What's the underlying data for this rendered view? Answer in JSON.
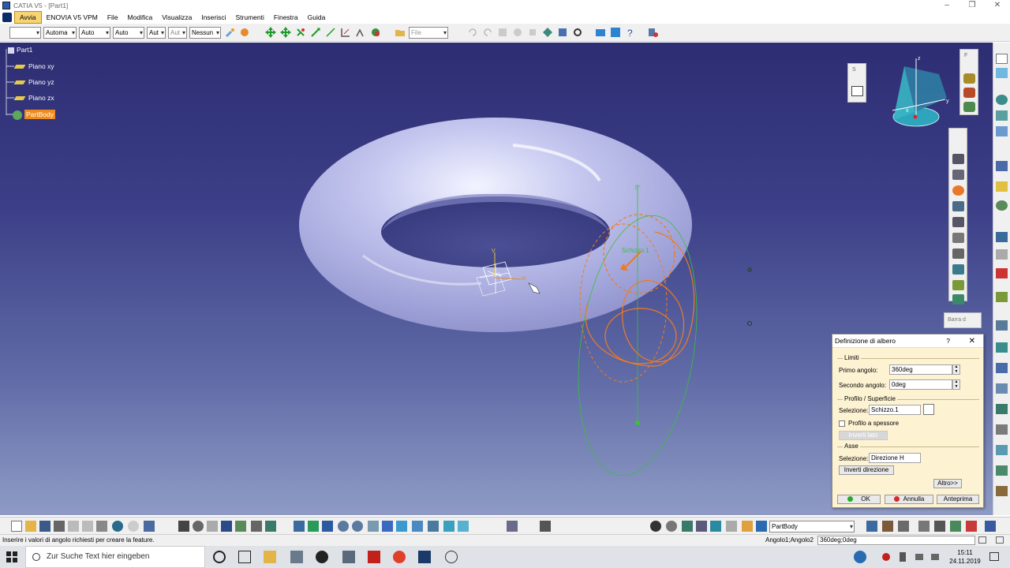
{
  "window": {
    "title": "CATIA V5 - [Part1]"
  },
  "menu": [
    "Avvia",
    "ENOVIA V5 VPM",
    "File",
    "Modifica",
    "Visualizza",
    "Inserisci",
    "Strumenti",
    "Finestra",
    "Guida"
  ],
  "toolbar_top": {
    "combos": [
      "",
      "Automa",
      "Auto",
      "Auto",
      "Aut",
      "Aut",
      "Nessun"
    ],
    "file_combo": "File"
  },
  "tree": {
    "root": "Part1",
    "items": [
      "Piano xy",
      "Piano yz",
      "Piano zx"
    ],
    "selected": "PartBody"
  },
  "viewport": {
    "panel_label_1": "S",
    "panel_label_2": "F",
    "barra_label": "Barra d",
    "sketch_label": "Schizzo.1",
    "compass_axis_x": "x",
    "compass_axis_y": "y",
    "compass_axis_z": "z",
    "point_label_h": "H",
    "point_label_v": "V"
  },
  "dialog": {
    "title": "Definizione di albero",
    "help": "?",
    "close": "✕",
    "limits_group": "Limiti",
    "first_angle_label": "Primo angolo:",
    "first_angle_value": "360deg",
    "second_angle_label": "Secondo angolo:",
    "second_angle_value": "0deg",
    "profile_group": "Profilo / Superficie",
    "selection_label": "Selezione:",
    "selection_value": "Schizzo.1",
    "thick_profile_label": "Profilo a spessore",
    "invert_side": "Inverti lato",
    "axis_group": "Asse",
    "axis_selection_label": "Selezione:",
    "axis_selection_value": "Direzione H",
    "invert_direction": "Inverti direzione",
    "more": "Altro>>",
    "ok": "OK",
    "cancel": "Annulla",
    "preview": "Anteprima"
  },
  "toolbar_bottom": {
    "body_combo": "PartBody"
  },
  "status": {
    "message": "Inserire i valori di angolo richiesti per creare la feature.",
    "right_label": "Angolo1;Angolo2",
    "right_value": "360deg;0deg"
  },
  "taskbar": {
    "search_placeholder": "Zur Suche Text hier eingeben",
    "time": "15:11",
    "date": "24.11.2019"
  },
  "colors": {
    "torus": "#c9cbf0",
    "selected_tree": "#ef8a1c",
    "sketch": "#f07a1e",
    "axis_green": "#38c03a",
    "dialog_bg": "#fdf2d2"
  }
}
